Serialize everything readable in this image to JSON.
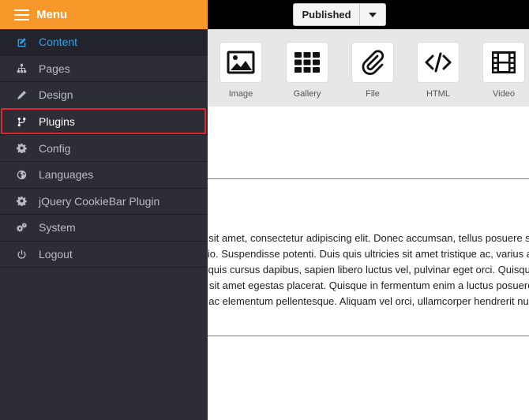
{
  "menu": {
    "title": "Menu"
  },
  "sidebar": {
    "items": [
      {
        "label": "Content",
        "icon": "edit-icon"
      },
      {
        "label": "Pages",
        "icon": "sitemap-icon"
      },
      {
        "label": "Design",
        "icon": "pencil-icon"
      },
      {
        "label": "Plugins",
        "icon": "plug-icon"
      },
      {
        "label": "Config",
        "icon": "gear-icon"
      },
      {
        "label": "Languages",
        "icon": "globe-icon"
      },
      {
        "label": "jQuery CookieBar Plugin",
        "icon": "gear-icon"
      },
      {
        "label": "System",
        "icon": "gears-icon"
      },
      {
        "label": "Logout",
        "icon": "power-icon"
      }
    ]
  },
  "topbar": {
    "publish_label": "Published"
  },
  "toolbar": {
    "tools": [
      {
        "label": "Image",
        "icon": "image-icon"
      },
      {
        "label": "Gallery",
        "icon": "grid-icon"
      },
      {
        "label": "File",
        "icon": "paperclip-icon"
      },
      {
        "label": "HTML",
        "icon": "code-icon"
      },
      {
        "label": "Video",
        "icon": "film-icon"
      }
    ]
  },
  "content": {
    "lines": [
      "Lorem ipsum dolor sit amet, consectetur adipiscing elit. Donec accumsan, tellus posuere sodales rhoncus, nulla nulla",
      "Donec non ante odio. Suspendisse potenti. Duis quis ultricies sit amet tristique ac, varius at nisi. Vivamus eros massa, aliquet at se",
      "Sed molestie, odio quis cursus dapibus, sapien libero luctus vel, pulvinar eget orci. Quisque sit amet posuere augue. Aenean sodales",
      "Cras volutpat nunc sit amet egestas placerat. Quisque in fermentum enim a luctus posuere. Mauris elementum facilisis urna, a ad",
      "Nunc dapibus odio ac elementum pellentesque. Aliquam vel orci, ullamcorper hendrerit nunc a, fringilla rhoncus est. Suspendisse laore"
    ]
  },
  "colors": {
    "accent": "#f8982a",
    "sidebar_bg": "#2c2d35",
    "active_text": "#2ea3f2",
    "highlight_border": "#e4232f"
  }
}
